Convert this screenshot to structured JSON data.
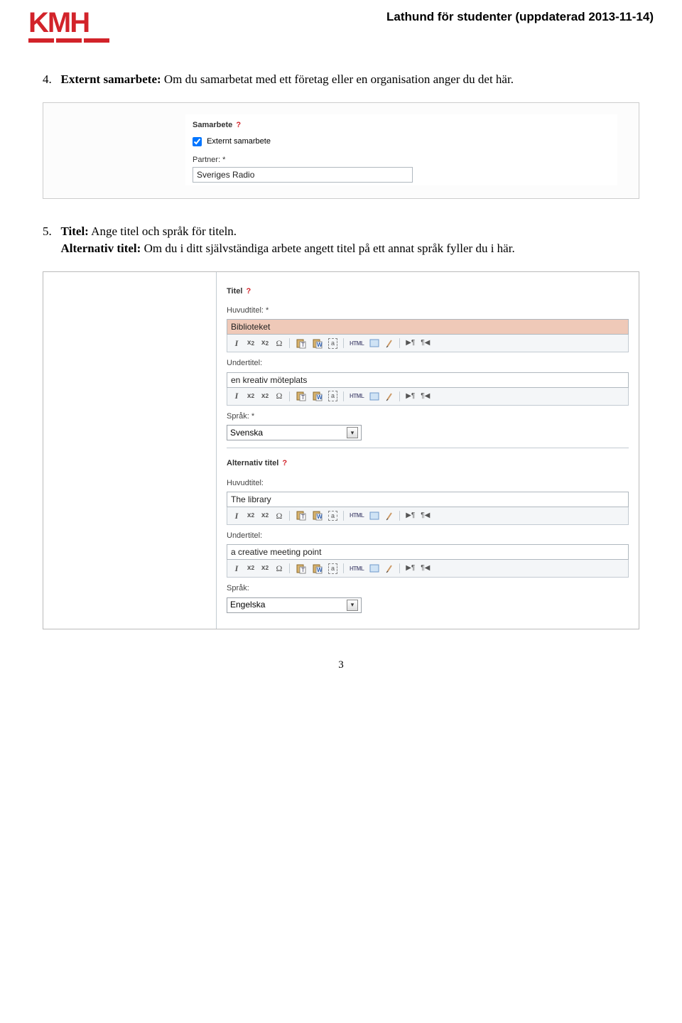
{
  "header": {
    "logo_text": "KMH",
    "doc_title": "Lathund för studenter (uppdaterad 2013-11-14)"
  },
  "section4": {
    "num": "4.",
    "label": "Externt samarbete:",
    "text": " Om du samarbetat med ett företag eller en organisation anger du det här."
  },
  "samarbete_panel": {
    "title": "Samarbete",
    "q": "?",
    "checkbox_checked": true,
    "checkbox_label": "Externt samarbete",
    "partner_label": "Partner: *",
    "partner_value": "Sveriges Radio"
  },
  "section5": {
    "num": "5.",
    "label_a": "Titel:",
    "text_a": " Ange titel och språk för titeln.",
    "label_b": "Alternativ titel:",
    "text_b": " Om du i ditt självständiga arbete angett titel på ett annat språk fyller du i här."
  },
  "titel_panel": {
    "titel": {
      "heading": "Titel",
      "q": "?",
      "huvud_label": "Huvudtitel: *",
      "huvud_value": "Biblioteket",
      "under_label": "Undertitel:",
      "under_value": "en kreativ möteplats",
      "sprak_label": "Språk: *",
      "sprak_value": "Svenska"
    },
    "alt": {
      "heading": "Alternativ titel",
      "q": "?",
      "huvud_label": "Huvudtitel:",
      "huvud_value": "The library",
      "under_label": "Undertitel:",
      "under_value": "a creative meeting point",
      "sprak_label": "Språk:",
      "sprak_value": "Engelska"
    }
  },
  "toolbar_icons": {
    "italic": "I",
    "sub": "×₂",
    "sup": "×²",
    "omega": "Ω",
    "paste_t": "T",
    "paste_w": "W",
    "a": "a",
    "html": "HTML",
    "pilcrow_l": "▶¶",
    "pilcrow_r": "¶◀"
  },
  "page_number": "3"
}
